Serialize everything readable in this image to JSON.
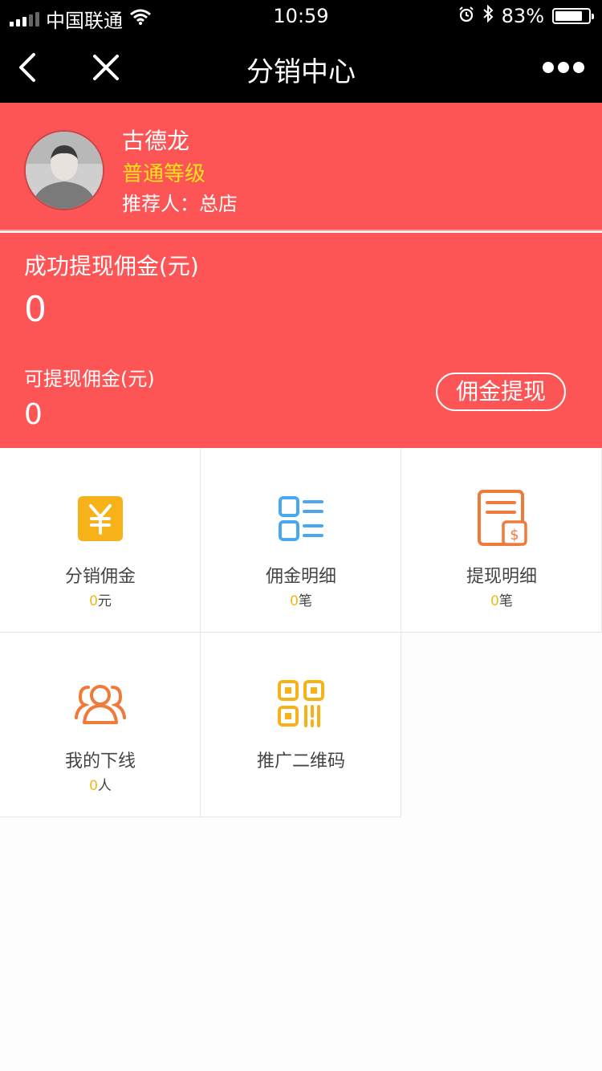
{
  "status_bar": {
    "carrier": "中国联通",
    "time": "10:59",
    "battery": "83%",
    "battery_level_percent": 83,
    "icons": [
      "signal-icon",
      "wifi-icon",
      "alarm-icon",
      "bluetooth-icon",
      "battery-icon"
    ]
  },
  "nav": {
    "title": "分销中心",
    "icons": [
      "back-icon",
      "close-icon",
      "more-icon"
    ]
  },
  "profile": {
    "name": "古德龙",
    "level": "普通等级",
    "referrer": "推荐人：总店"
  },
  "commission": {
    "success_label": "成功提现佣金(元)",
    "success_value": "0",
    "available_label": "可提现佣金(元)",
    "available_value": "0",
    "withdraw_button": "佣金提现"
  },
  "grid": [
    {
      "label": "分销佣金",
      "value": "0",
      "unit": "元",
      "icon": "yuan-icon"
    },
    {
      "label": "佣金明细",
      "value": "0",
      "unit": "笔",
      "icon": "list-icon"
    },
    {
      "label": "提现明细",
      "value": "0",
      "unit": "笔",
      "icon": "withdraw-record-icon"
    },
    {
      "label": "我的下线",
      "value": "0",
      "unit": "人",
      "icon": "users-icon"
    },
    {
      "label": "推广二维码",
      "icon": "qrcode-icon"
    }
  ],
  "colors": {
    "brand_red": "#fd5555",
    "level_yellow": "#ffe21a",
    "count_yellow": "#f4b61a",
    "icon_blue": "#4aa8f0",
    "icon_orange": "#f07a3a",
    "icon_amber": "#f7b21a"
  }
}
